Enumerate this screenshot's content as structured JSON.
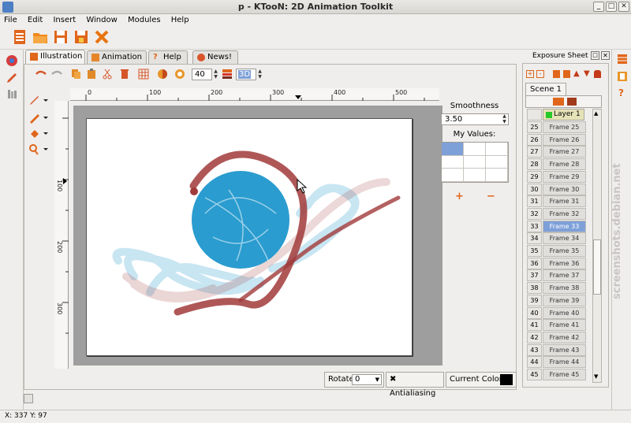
{
  "window": {
    "title": "p - KTooN: 2D Animation Toolkit"
  },
  "menu": [
    "File",
    "Edit",
    "Insert",
    "Window",
    "Modules",
    "Help"
  ],
  "tabs": [
    {
      "label": "Illustration",
      "icon": "pencil-icon"
    },
    {
      "label": "Animation",
      "icon": "film-icon"
    },
    {
      "label": "Help",
      "icon": "question-icon"
    },
    {
      "label": "News!",
      "icon": "news-icon"
    }
  ],
  "toolbar": {
    "brush_size": "40",
    "mode_value": "3D"
  },
  "ruler": {
    "h_ticks": [
      "0",
      "100",
      "200",
      "300",
      "400",
      "500"
    ],
    "v_ticks": [
      "100",
      "200",
      "300"
    ]
  },
  "panel": {
    "smoothness_label": "Smoothness",
    "smoothness_value": "3.50",
    "my_values_label": "My Values:",
    "plus": "+",
    "minus": "−"
  },
  "bottom": {
    "rotate_label": "Rotate",
    "rotate_value": "0",
    "antialiasing_label": "Antialiasing",
    "current_color_label": "Current Color"
  },
  "exposure": {
    "title": "Exposure Sheet",
    "scene": "Scene 1",
    "layer": "Layer 1",
    "frames": [
      {
        "n": "25",
        "label": "Frame 25"
      },
      {
        "n": "26",
        "label": "Frame 26"
      },
      {
        "n": "27",
        "label": "Frame 27"
      },
      {
        "n": "28",
        "label": "Frame 28"
      },
      {
        "n": "29",
        "label": "Frame 29"
      },
      {
        "n": "30",
        "label": "Frame 30"
      },
      {
        "n": "31",
        "label": "Frame 31"
      },
      {
        "n": "32",
        "label": "Frame 32"
      },
      {
        "n": "33",
        "label": "Frame 33"
      },
      {
        "n": "34",
        "label": "Frame 34"
      },
      {
        "n": "35",
        "label": "Frame 35"
      },
      {
        "n": "36",
        "label": "Frame 36"
      },
      {
        "n": "37",
        "label": "Frame 37"
      },
      {
        "n": "38",
        "label": "Frame 38"
      },
      {
        "n": "39",
        "label": "Frame 39"
      },
      {
        "n": "40",
        "label": "Frame 40"
      },
      {
        "n": "41",
        "label": "Frame 41"
      },
      {
        "n": "42",
        "label": "Frame 42"
      },
      {
        "n": "43",
        "label": "Frame 43"
      },
      {
        "n": "44",
        "label": "Frame 44"
      },
      {
        "n": "45",
        "label": "Frame 45"
      }
    ],
    "selected_frame": "33"
  },
  "status": "X: 337 Y: 97",
  "watermark": "screenshots.debian.net",
  "colors": {
    "accent": "#7ea0d8",
    "stroke_red": "#a13a3a",
    "fill_blue": "#2a9ccf",
    "current_color": "#000000"
  }
}
